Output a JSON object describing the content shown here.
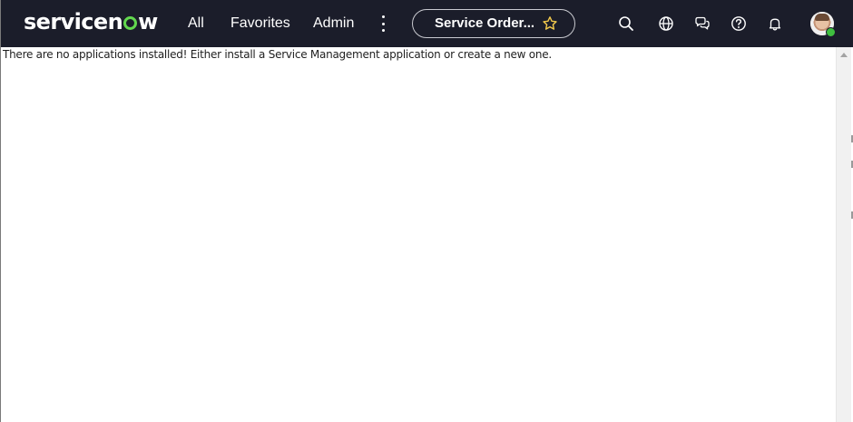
{
  "header": {
    "logo_text_a": "servicen",
    "logo_text_b": "w",
    "nav": {
      "all": "All",
      "favorites": "Favorites",
      "admin": "Admin"
    },
    "pinned_page": {
      "label": "Service Order..."
    },
    "icons": [
      "more-vertical-icon",
      "star-icon",
      "search-icon",
      "globe-icon",
      "chat-icon",
      "help-icon",
      "bell-icon"
    ],
    "avatar": {
      "status_color": "#3fbf3f"
    },
    "background_color": "#1b1d2a",
    "brand_accent_color": "#62d84e"
  },
  "main": {
    "message": "There are no applications installed! Either install a Service Management application or create a new one."
  }
}
